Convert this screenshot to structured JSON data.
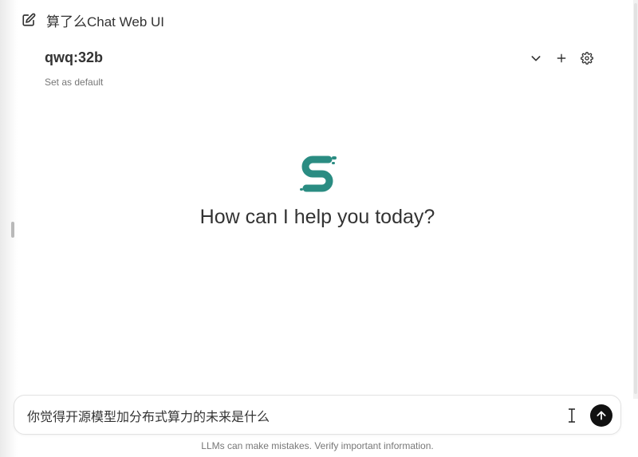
{
  "header": {
    "app_title": "算了么Chat Web UI",
    "new_chat_icon": "edit-square-icon"
  },
  "model": {
    "name": "qwq:32b",
    "set_default_label": "Set as default",
    "actions": [
      "chevron-down-icon",
      "plus-icon",
      "gear-icon"
    ]
  },
  "main": {
    "logo_icon": "brand-s-logo",
    "logo_color": "#2a8c82",
    "greeting": "How can I help you today?"
  },
  "composer": {
    "value": "你觉得开源模型加分布式算力的未来是什么",
    "send_icon": "arrow-up-icon",
    "send_color": "#111111"
  },
  "footer": {
    "disclaimer": "LLMs can make mistakes. Verify important information."
  }
}
